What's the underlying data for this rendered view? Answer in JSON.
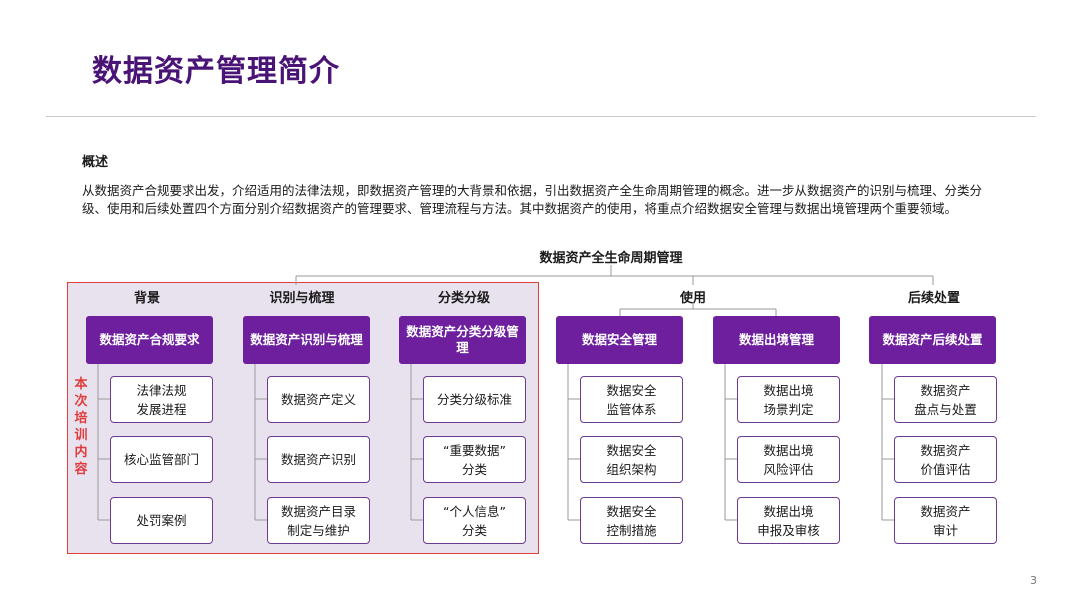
{
  "title": "数据资产管理简介",
  "overview": {
    "heading": "概述",
    "text": "从数据资产合规要求出发，介绍适用的法律法规，即数据资产管理的大背景和依据，引出数据资产全生命周期管理的概念。进一步从数据资产的识别与梳理、分类分级、使用和后续处置四个方面分别介绍数据资产的管理要求、管理流程与方法。其中数据资产的使用，将重点介绍数据安全管理与数据出境管理两个重要领域。"
  },
  "diagram": {
    "root": "数据资产全生命周期管理",
    "categories": [
      "背景",
      "识别与梳理",
      "分类分级",
      "使用",
      "后续处置"
    ],
    "heads": [
      "数据资产合规要求",
      "数据资产识别与梳理",
      "数据资产分类分级管理",
      "数据安全管理",
      "数据出境管理",
      "数据资产后续处置"
    ],
    "leaves": [
      [
        "法律法规\n发展进程",
        "核心监管部门",
        "处罚案例"
      ],
      [
        "数据资产定义",
        "数据资产识别",
        "数据资产目录\n制定与维护"
      ],
      [
        "分类分级标准",
        "“重要数据”\n分类",
        "“个人信息”\n分类"
      ],
      [
        "数据安全\n监管体系",
        "数据安全\n组织架构",
        "数据安全\n控制措施"
      ],
      [
        "数据出境\n场景判定",
        "数据出境\n风险评估",
        "数据出境\n申报及审核"
      ],
      [
        "数据资产\n盘点与处置",
        "数据资产\n价值评估",
        "数据资产\n审计"
      ]
    ],
    "training_note": "本次培训内容"
  },
  "page_number": "3",
  "colors": {
    "title": "#4a1477",
    "head_fill": "#6d1f9e",
    "leaf_border": "#6d3a92",
    "highlight_fill": "#e8e1ee",
    "highlight_border": "#e13b3b"
  }
}
